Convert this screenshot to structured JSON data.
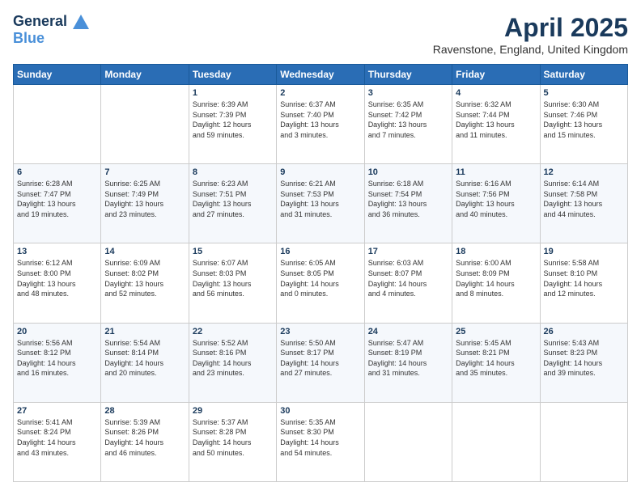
{
  "header": {
    "logo_line1": "General",
    "logo_line2": "Blue",
    "month_year": "April 2025",
    "location": "Ravenstone, England, United Kingdom"
  },
  "days_of_week": [
    "Sunday",
    "Monday",
    "Tuesday",
    "Wednesday",
    "Thursday",
    "Friday",
    "Saturday"
  ],
  "weeks": [
    [
      {
        "day": "",
        "info": ""
      },
      {
        "day": "",
        "info": ""
      },
      {
        "day": "1",
        "info": "Sunrise: 6:39 AM\nSunset: 7:39 PM\nDaylight: 12 hours\nand 59 minutes."
      },
      {
        "day": "2",
        "info": "Sunrise: 6:37 AM\nSunset: 7:40 PM\nDaylight: 13 hours\nand 3 minutes."
      },
      {
        "day": "3",
        "info": "Sunrise: 6:35 AM\nSunset: 7:42 PM\nDaylight: 13 hours\nand 7 minutes."
      },
      {
        "day": "4",
        "info": "Sunrise: 6:32 AM\nSunset: 7:44 PM\nDaylight: 13 hours\nand 11 minutes."
      },
      {
        "day": "5",
        "info": "Sunrise: 6:30 AM\nSunset: 7:46 PM\nDaylight: 13 hours\nand 15 minutes."
      }
    ],
    [
      {
        "day": "6",
        "info": "Sunrise: 6:28 AM\nSunset: 7:47 PM\nDaylight: 13 hours\nand 19 minutes."
      },
      {
        "day": "7",
        "info": "Sunrise: 6:25 AM\nSunset: 7:49 PM\nDaylight: 13 hours\nand 23 minutes."
      },
      {
        "day": "8",
        "info": "Sunrise: 6:23 AM\nSunset: 7:51 PM\nDaylight: 13 hours\nand 27 minutes."
      },
      {
        "day": "9",
        "info": "Sunrise: 6:21 AM\nSunset: 7:53 PM\nDaylight: 13 hours\nand 31 minutes."
      },
      {
        "day": "10",
        "info": "Sunrise: 6:18 AM\nSunset: 7:54 PM\nDaylight: 13 hours\nand 36 minutes."
      },
      {
        "day": "11",
        "info": "Sunrise: 6:16 AM\nSunset: 7:56 PM\nDaylight: 13 hours\nand 40 minutes."
      },
      {
        "day": "12",
        "info": "Sunrise: 6:14 AM\nSunset: 7:58 PM\nDaylight: 13 hours\nand 44 minutes."
      }
    ],
    [
      {
        "day": "13",
        "info": "Sunrise: 6:12 AM\nSunset: 8:00 PM\nDaylight: 13 hours\nand 48 minutes."
      },
      {
        "day": "14",
        "info": "Sunrise: 6:09 AM\nSunset: 8:02 PM\nDaylight: 13 hours\nand 52 minutes."
      },
      {
        "day": "15",
        "info": "Sunrise: 6:07 AM\nSunset: 8:03 PM\nDaylight: 13 hours\nand 56 minutes."
      },
      {
        "day": "16",
        "info": "Sunrise: 6:05 AM\nSunset: 8:05 PM\nDaylight: 14 hours\nand 0 minutes."
      },
      {
        "day": "17",
        "info": "Sunrise: 6:03 AM\nSunset: 8:07 PM\nDaylight: 14 hours\nand 4 minutes."
      },
      {
        "day": "18",
        "info": "Sunrise: 6:00 AM\nSunset: 8:09 PM\nDaylight: 14 hours\nand 8 minutes."
      },
      {
        "day": "19",
        "info": "Sunrise: 5:58 AM\nSunset: 8:10 PM\nDaylight: 14 hours\nand 12 minutes."
      }
    ],
    [
      {
        "day": "20",
        "info": "Sunrise: 5:56 AM\nSunset: 8:12 PM\nDaylight: 14 hours\nand 16 minutes."
      },
      {
        "day": "21",
        "info": "Sunrise: 5:54 AM\nSunset: 8:14 PM\nDaylight: 14 hours\nand 20 minutes."
      },
      {
        "day": "22",
        "info": "Sunrise: 5:52 AM\nSunset: 8:16 PM\nDaylight: 14 hours\nand 23 minutes."
      },
      {
        "day": "23",
        "info": "Sunrise: 5:50 AM\nSunset: 8:17 PM\nDaylight: 14 hours\nand 27 minutes."
      },
      {
        "day": "24",
        "info": "Sunrise: 5:47 AM\nSunset: 8:19 PM\nDaylight: 14 hours\nand 31 minutes."
      },
      {
        "day": "25",
        "info": "Sunrise: 5:45 AM\nSunset: 8:21 PM\nDaylight: 14 hours\nand 35 minutes."
      },
      {
        "day": "26",
        "info": "Sunrise: 5:43 AM\nSunset: 8:23 PM\nDaylight: 14 hours\nand 39 minutes."
      }
    ],
    [
      {
        "day": "27",
        "info": "Sunrise: 5:41 AM\nSunset: 8:24 PM\nDaylight: 14 hours\nand 43 minutes."
      },
      {
        "day": "28",
        "info": "Sunrise: 5:39 AM\nSunset: 8:26 PM\nDaylight: 14 hours\nand 46 minutes."
      },
      {
        "day": "29",
        "info": "Sunrise: 5:37 AM\nSunset: 8:28 PM\nDaylight: 14 hours\nand 50 minutes."
      },
      {
        "day": "30",
        "info": "Sunrise: 5:35 AM\nSunset: 8:30 PM\nDaylight: 14 hours\nand 54 minutes."
      },
      {
        "day": "",
        "info": ""
      },
      {
        "day": "",
        "info": ""
      },
      {
        "day": "",
        "info": ""
      }
    ]
  ]
}
